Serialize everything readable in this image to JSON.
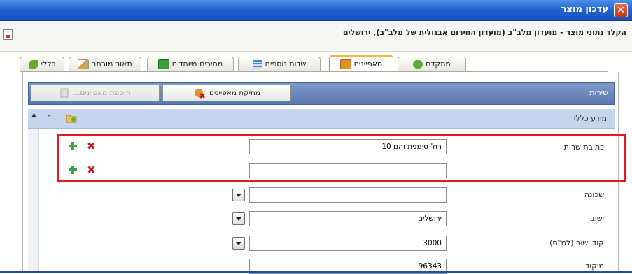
{
  "window": {
    "title": "עדכון מוצר",
    "close_label": "✕"
  },
  "header": {
    "breadcrumb": "הקלד נתוני מוצר - מועדון מלב\"ב (מועדון החירום אבגולית של מלב\"ב), ירושלים"
  },
  "tabs": [
    {
      "label": "כללי",
      "icon": "leaf-icon",
      "color": "#6aa82e"
    },
    {
      "label": "תאור מורחב",
      "icon": "pencil-icon",
      "color": "#d0a550"
    },
    {
      "label": "מחירים מיוחדים",
      "icon": "price-icon",
      "color": "#3d9b3a"
    },
    {
      "label": "שדות נוספים",
      "icon": "fields-icon",
      "color": "#4a82d4"
    },
    {
      "label": "מאפיינים",
      "icon": "attributes-icon",
      "color": "#e2902b",
      "active": true
    },
    {
      "label": "מתקדם",
      "icon": "advanced-icon",
      "color": "#63a83a"
    }
  ],
  "toolbar": {
    "title": "שירות",
    "manage_button": "מחיקת מאפיינים",
    "add_button": "הוספת מאפיינים..."
  },
  "section": {
    "title": "מידע כללי",
    "collapse_symbol": "⌃"
  },
  "fields": [
    {
      "label": "כתובת שרות",
      "value": "רח' סימנית והמ 10"
    },
    {
      "label": "",
      "value": ""
    },
    {
      "label": "שכונה",
      "value": ""
    },
    {
      "label": "ישוב",
      "value": "ירושלים"
    },
    {
      "label": "קוד ישוב (למ\"ס)",
      "value": "3000"
    },
    {
      "label": "מיקוד",
      "value": "96343"
    }
  ],
  "colors": {
    "titlebar": "#1f5fcf",
    "toolbar": "#5a78b0",
    "highlight": "#e11d23",
    "add": "#3aa53a",
    "remove": "#c0171b"
  }
}
